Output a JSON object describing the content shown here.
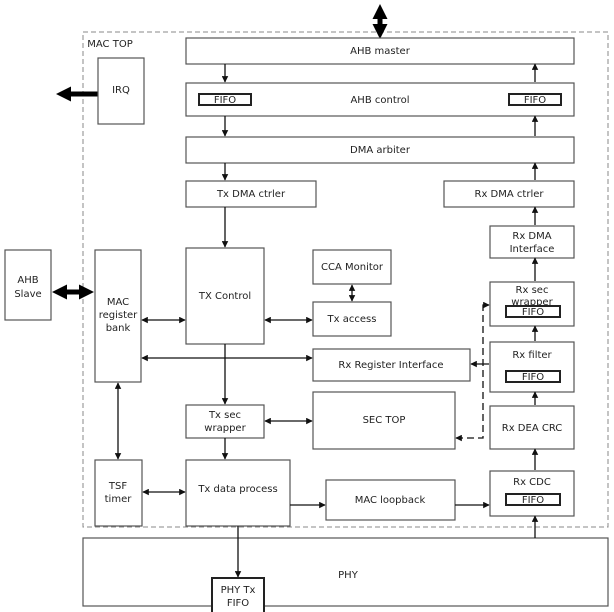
{
  "diagram": {
    "container_label": "MAC TOP",
    "blocks": {
      "ahb_master": "AHB master",
      "ahb_control": "AHB control",
      "fifo": "FIFO",
      "dma_arbiter": "DMA arbiter",
      "tx_dma_ctrler": "Tx DMA ctrler",
      "rx_dma_ctrler": "Rx DMA ctrler",
      "rx_dma_interface": [
        "Rx DMA",
        "Interface"
      ],
      "irq": "IRQ",
      "ahb_slave": [
        "AHB",
        "Slave"
      ],
      "mac_register_bank": [
        "MAC",
        "register",
        "bank"
      ],
      "tx_control": "TX Control",
      "cca_monitor": "CCA Monitor",
      "tx_access": "Tx access",
      "rx_sec_wrapper": [
        "Rx sec",
        "wrapper"
      ],
      "rx_register_interface": "Rx Register Interface",
      "rx_filter": "Rx filter",
      "tx_sec_wrapper": [
        "Tx sec",
        "wrapper"
      ],
      "sec_top": "SEC TOP",
      "rx_dea_crc": "Rx DEA CRC",
      "tsf_timer": [
        "TSF",
        "timer"
      ],
      "tx_data_process": "Tx data process",
      "mac_loopback": "MAC loopback",
      "rx_cdc": "Rx CDC",
      "phy": "PHY",
      "phy_tx_fifo": [
        "PHY Tx",
        "FIFO"
      ]
    }
  }
}
